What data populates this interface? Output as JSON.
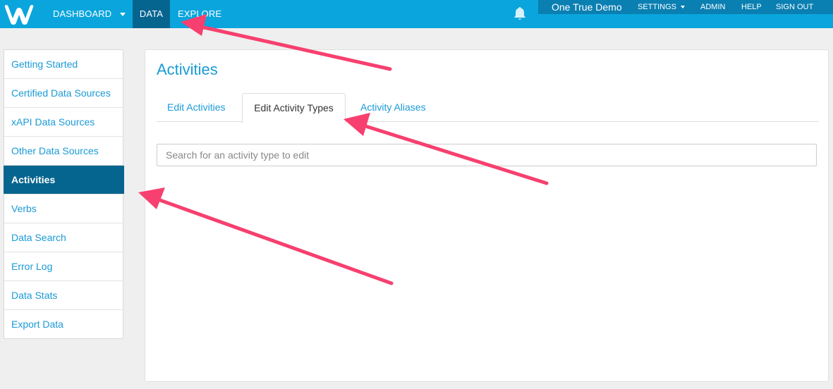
{
  "topbar": {
    "logo_icon": "w-logo-icon",
    "nav": {
      "dashboard": "DASHBOARD",
      "data": "DATA",
      "explore": "EXPLORE"
    },
    "account": {
      "name": "One True Demo",
      "settings": "SETTINGS",
      "admin": "ADMIN",
      "help": "HELP",
      "signout": "SIGN OUT"
    }
  },
  "sidebar": {
    "items": [
      {
        "label": "Getting Started"
      },
      {
        "label": "Certified Data Sources"
      },
      {
        "label": "xAPI Data Sources"
      },
      {
        "label": "Other Data Sources"
      },
      {
        "label": "Activities",
        "active": true
      },
      {
        "label": "Verbs"
      },
      {
        "label": "Data Search"
      },
      {
        "label": "Error Log"
      },
      {
        "label": "Data Stats"
      },
      {
        "label": "Export Data"
      }
    ]
  },
  "main": {
    "title": "Activities",
    "tabs": [
      {
        "label": "Edit Activities"
      },
      {
        "label": "Edit Activity Types",
        "active": true
      },
      {
        "label": "Activity Aliases"
      }
    ],
    "search": {
      "placeholder": "Search for an activity type to edit",
      "value": ""
    }
  },
  "colors": {
    "topbar": "#0aa5dd",
    "topbar_active": "#06658f",
    "account_bar": "#0a7fb2",
    "link": "#1a9ad6",
    "sidebar_active": "#06658f",
    "annotation_arrow": "#f7406f"
  }
}
